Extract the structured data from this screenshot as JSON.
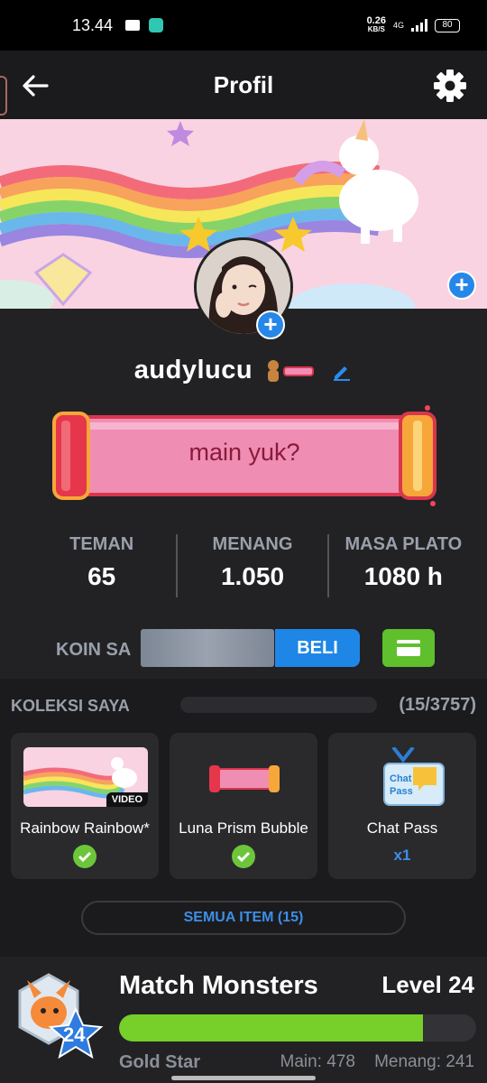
{
  "status_bar": {
    "time": "13.44",
    "speed_value": "0.26",
    "speed_unit": "KB/S",
    "network": "4G",
    "battery": "80"
  },
  "header": {
    "title": "Profil",
    "back_icon": "arrow-left-icon",
    "settings_icon": "gear-icon"
  },
  "profile": {
    "username": "audylucu",
    "status_message": "main yuk?"
  },
  "stats": [
    {
      "label": "TEMAN",
      "value": "65"
    },
    {
      "label": "MENANG",
      "value": "1.050"
    },
    {
      "label": "MASA PLATO",
      "value": "1080 h"
    }
  ],
  "coins": {
    "label": "KOIN SA",
    "buy_label": "BELI",
    "wallet_icon": "wallet-icon"
  },
  "collection": {
    "title": "KOLEKSI SAYA",
    "count": "(15/3757)",
    "items": [
      {
        "name": "Rainbow Rainbow*",
        "tag": "VIDEO",
        "owned": true
      },
      {
        "name": "Luna Prism Bubble",
        "owned": true
      },
      {
        "name": "Chat Pass",
        "quantity": "x1"
      }
    ],
    "all_items_label": "SEMUA ITEM (15)"
  },
  "game": {
    "name": "Match Monsters",
    "level": "Level 24",
    "badge_level": "24",
    "progress": 0.85,
    "rank": "Gold Star",
    "plays": "Main: 478",
    "wins": "Menang: 241"
  },
  "colors": {
    "accent_blue": "#1e86e6",
    "accent_green": "#77cf2a",
    "background": "#222224"
  }
}
